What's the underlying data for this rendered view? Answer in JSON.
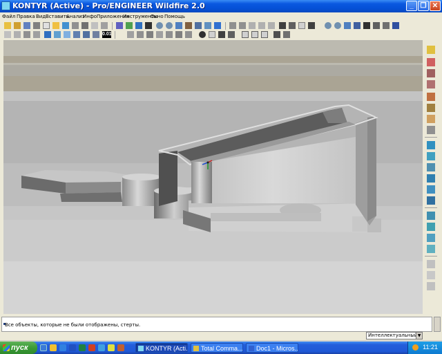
{
  "window": {
    "title": "KONTYR (Active) - Pro/ENGINEER Wildfire 2.0",
    "minimize_glyph": "_",
    "restore_glyph": "❐",
    "close_glyph": "✕"
  },
  "menu": [
    {
      "label": "Файл"
    },
    {
      "label": "Правка"
    },
    {
      "label": "Вид"
    },
    {
      "label": "Вставить"
    },
    {
      "label": "Анализ"
    },
    {
      "label": "Инфо"
    },
    {
      "label": "Приложения"
    },
    {
      "label": "Инструменты"
    },
    {
      "label": "Окно"
    },
    {
      "label": "Помощь"
    }
  ],
  "toolbar": {
    "precision_value": "0.01"
  },
  "message": {
    "text": "Все объекты, которые не были отображены, стерты."
  },
  "filter": {
    "value": "Интеллектуальный",
    "dropdown_glyph": "▼"
  },
  "taskbar": {
    "start_label": "пуск",
    "items": [
      {
        "label": "KONTYR (Acti..."
      },
      {
        "label": "Total Comma..."
      },
      {
        "label": "Doc1 - Micros..."
      }
    ],
    "clock": "11:21"
  },
  "colors": {
    "titlebar": "#0550d6",
    "taskbar": "#245edb",
    "start": "#3b9a36",
    "model_light": "#d6d6d6",
    "model_dark": "#6a6a6a"
  }
}
